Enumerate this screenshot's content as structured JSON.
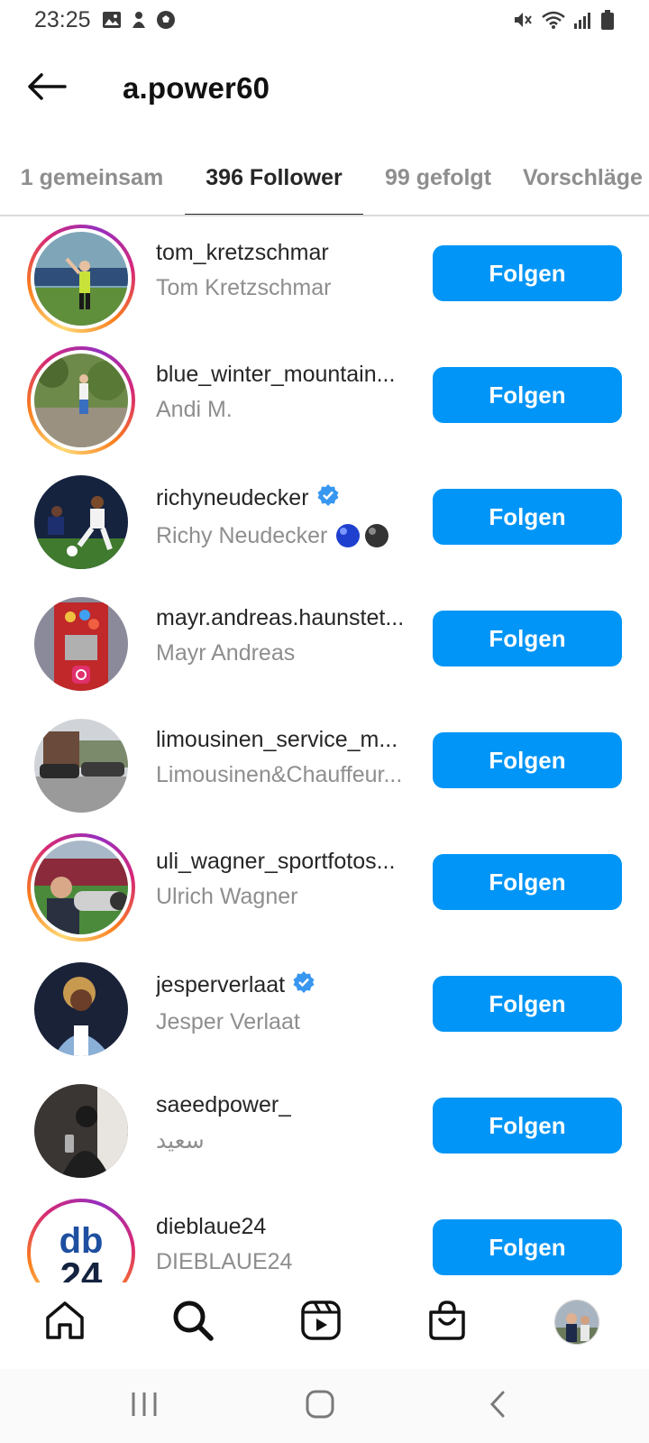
{
  "status_bar": {
    "time": "23:25",
    "left_icons": [
      "image-icon",
      "notification-app-icon",
      "soccer-ball-icon"
    ],
    "right_icons": [
      "mute-icon",
      "wifi-icon",
      "signal-icon",
      "battery-icon"
    ]
  },
  "header": {
    "title": "a.power60",
    "back_icon": "back-arrow-icon"
  },
  "tabs": [
    {
      "label": "1 gemeinsam",
      "active": false
    },
    {
      "label": "396 Follower",
      "active": true
    },
    {
      "label": "99 gefolgt",
      "active": false
    },
    {
      "label": "Vorschläge",
      "active": false
    }
  ],
  "follow_label": "Folgen",
  "users": [
    {
      "username": "tom_kretzschmar",
      "full_name": "Tom Kretzschmar",
      "verified": false,
      "story": true
    },
    {
      "username": "blue_winter_mountain...",
      "full_name": "Andi M.",
      "verified": false,
      "story": true
    },
    {
      "username": "richyneudecker",
      "full_name": "Richy Neudecker",
      "verified": true,
      "story": false,
      "emoji": [
        "blue-ball",
        "black-ball"
      ]
    },
    {
      "username": "mayr.andreas.haunstet...",
      "full_name": "Mayr Andreas",
      "verified": false,
      "story": false
    },
    {
      "username": "limousinen_service_m...",
      "full_name": "Limousinen&Chauffeur...",
      "verified": false,
      "story": false
    },
    {
      "username": "uli_wagner_sportfotos...",
      "full_name": "Ulrich Wagner",
      "verified": false,
      "story": true
    },
    {
      "username": "jesperverlaat",
      "full_name": "Jesper Verlaat",
      "verified": true,
      "story": false
    },
    {
      "username": "saeedpower_",
      "full_name": "سعید",
      "verified": false,
      "story": false
    },
    {
      "username": "dieblaue24",
      "full_name": "DIEBLAUE24",
      "verified": false,
      "story": true
    }
  ],
  "bottom_nav": [
    "home-icon",
    "search-icon",
    "reels-icon",
    "shop-icon",
    "profile-avatar"
  ],
  "system_nav": [
    "recent-apps-icon",
    "home-button-icon",
    "back-icon"
  ],
  "colors": {
    "accent": "#0095f6",
    "text_primary": "#262626",
    "text_secondary": "#8e8e8e",
    "divider": "#dbdbdb",
    "verified": "#3897f0"
  }
}
